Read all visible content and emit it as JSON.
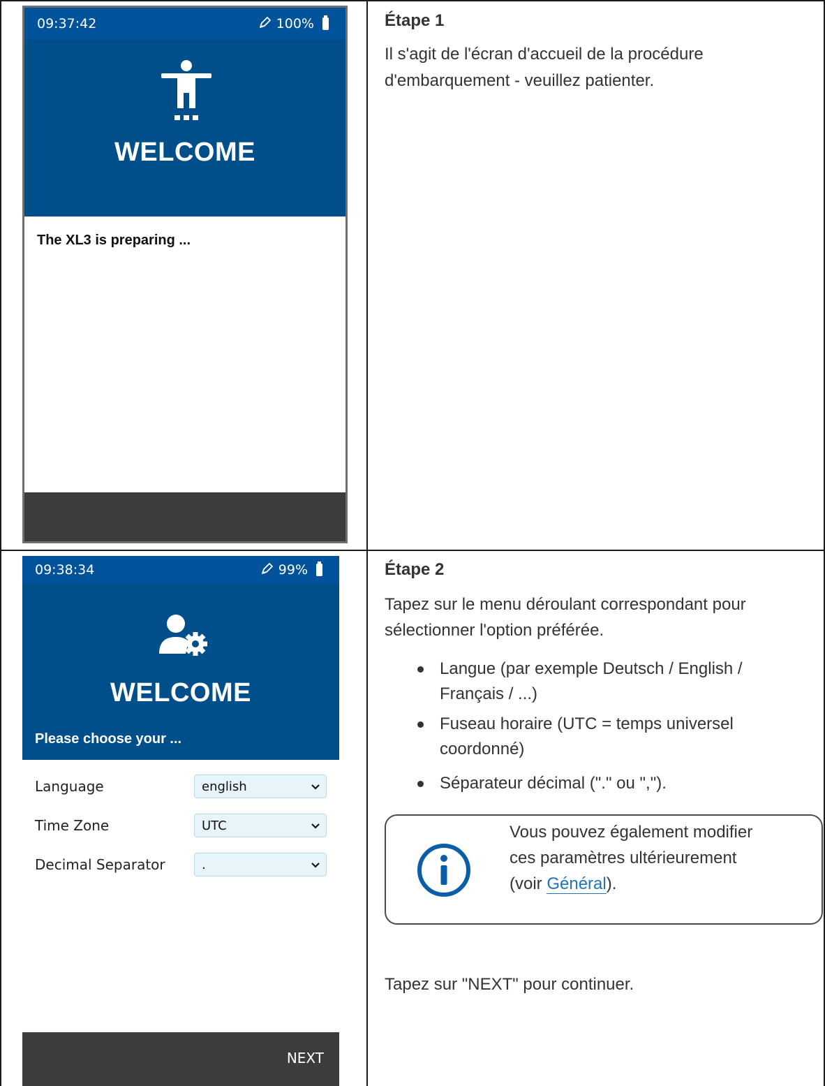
{
  "step1": {
    "screen": {
      "time": "09:37:42",
      "battery": "100%",
      "hero_title": "WELCOME",
      "status_message": "The XL3 is preparing ..."
    },
    "heading": "Étape 1",
    "text_line1": "Il s'agit de l'écran d'accueil de la procédure",
    "text_line2": "d'embarquement - veuillez patienter."
  },
  "step2": {
    "screen": {
      "time": "09:38:34",
      "battery": "99%",
      "hero_title": "WELCOME",
      "choose_label": "Please choose your ...",
      "fields": [
        {
          "label": "Language",
          "value": "english"
        },
        {
          "label": "Time Zone",
          "value": "UTC"
        },
        {
          "label": "Decimal Separator",
          "value": "."
        }
      ],
      "next_label": "NEXT"
    },
    "heading": "Étape 2",
    "intro_line1": "Tapez sur le menu déroulant correspondant pour",
    "intro_line2": "sélectionner l'option préférée.",
    "bullets": [
      {
        "line1": "Langue (par exemple Deutsch / English /",
        "line2": "Français / ...)"
      },
      {
        "line1": "Fuseau horaire (UTC = temps universel",
        "line2": "coordonné)"
      },
      {
        "line1": "Séparateur décimal (\".\" ou \",\").",
        "line2": ""
      }
    ],
    "note": {
      "line1": "Vous pouvez également modifier",
      "line2": "ces paramètres ultérieurement",
      "line3_prefix": "(voir ",
      "link": "Général",
      "line3_suffix": ")."
    },
    "outro": "Tapez sur \"NEXT\" pour continuer."
  },
  "colors": {
    "status_bar": "#00529b",
    "hero": "#004f8a",
    "footer": "#3c3c3c",
    "link": "#1e73be",
    "info": "#0a5ea8"
  }
}
